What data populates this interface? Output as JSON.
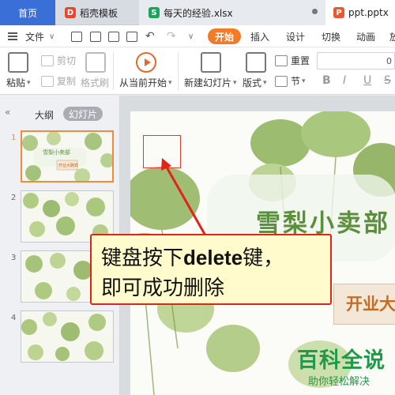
{
  "tabs": {
    "home": "首页",
    "docer": "稻壳模板",
    "docer_icon": "D",
    "excel": "每天的经验.xlsx",
    "excel_icon": "S",
    "ppt": "ppt.pptx",
    "ppt_icon": "P"
  },
  "menu": {
    "file": "文件",
    "file_caret": "∨",
    "start": "开始",
    "insert": "插入",
    "design": "设计",
    "switch": "切换",
    "animation": "动画",
    "slideshow": "放"
  },
  "ribbon": {
    "paste": "粘贴",
    "cut": "剪切",
    "copy": "复制",
    "format_painter": "格式刷",
    "from_current": "从当前开始",
    "new_slide": "新建幻灯片",
    "layout": "版式",
    "reset": "重置",
    "section": "节",
    "font_size": "0",
    "bold": "B",
    "italic": "I",
    "underline": "U",
    "strike": "S"
  },
  "left_pane": {
    "collapse": "«",
    "outline": "大纲",
    "slides": "幻灯片",
    "slide_numbers": [
      "1",
      "2",
      "3",
      "4"
    ],
    "thumb1_title": "雪梨小卖部",
    "thumb1_sub": "开业大酬宾"
  },
  "slide": {
    "title": "雪梨小卖部",
    "subtitle": "开业大"
  },
  "callout": {
    "prefix": "键盘按下",
    "key": "delete",
    "suffix": "键，",
    "line2": "即可成功删除"
  },
  "watermark": {
    "title": "百科全说",
    "subtitle": "助你轻松解决"
  },
  "colors": {
    "accent_orange": "#f27b2a",
    "callout_border": "#e2231a",
    "callout_fill": "#fffbcc",
    "watermark_green": "#1f9a4a",
    "title_green": "#5c8f3b"
  }
}
